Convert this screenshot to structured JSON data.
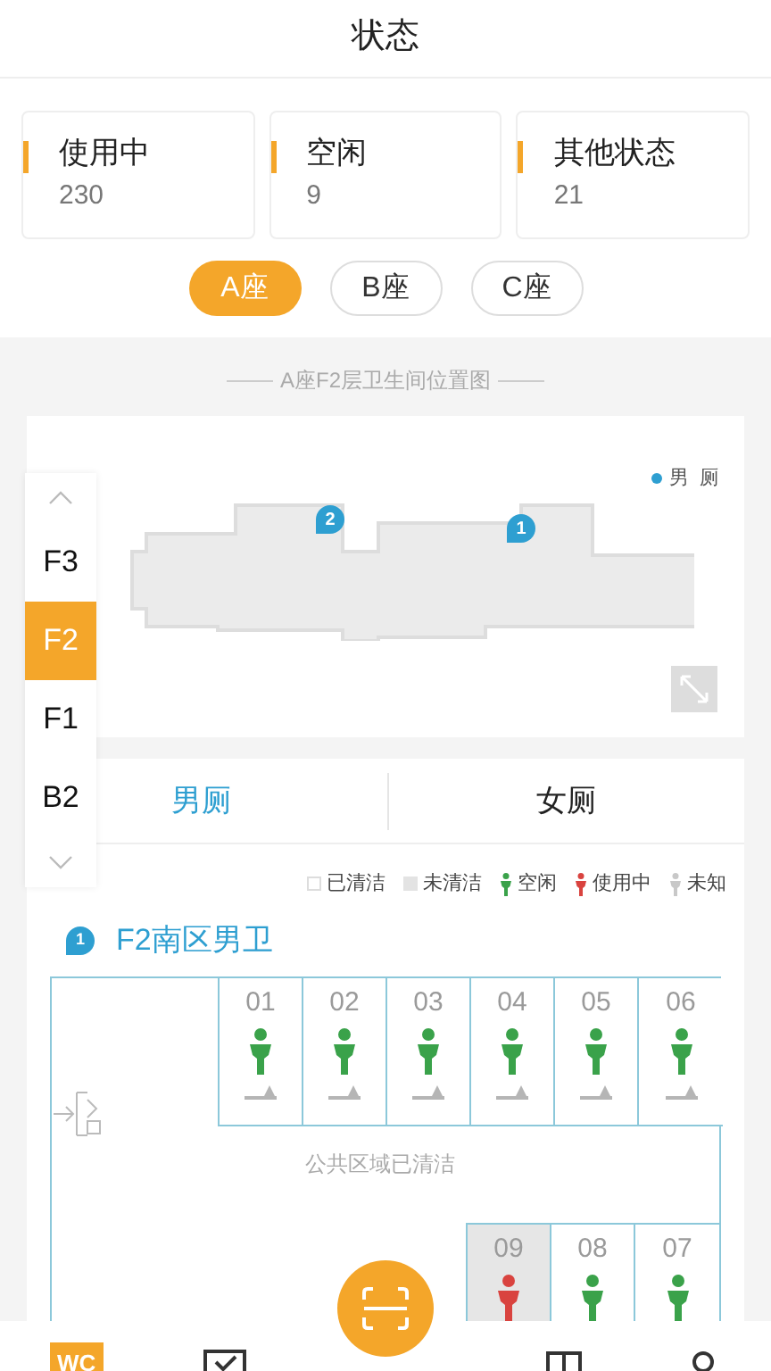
{
  "header": {
    "title": "状态"
  },
  "stats": [
    {
      "label": "使用中",
      "value": "230"
    },
    {
      "label": "空闲",
      "value": "9"
    },
    {
      "label": "其他状态",
      "value": "21"
    }
  ],
  "buildings": [
    {
      "label": "A座",
      "selected": true
    },
    {
      "label": "B座",
      "selected": false
    },
    {
      "label": "C座",
      "selected": false
    }
  ],
  "map": {
    "title": "A座F2层卫生间位置图",
    "legend": "男  厕",
    "pins": [
      {
        "number": "2"
      },
      {
        "number": "1"
      }
    ]
  },
  "floors": [
    {
      "label": "F3",
      "selected": false
    },
    {
      "label": "F2",
      "selected": true
    },
    {
      "label": "F1",
      "selected": false
    },
    {
      "label": "B2",
      "selected": false
    }
  ],
  "gender_tabs": [
    {
      "label": "男厕",
      "selected": true
    },
    {
      "label": "女厕",
      "selected": false
    }
  ],
  "legend": [
    {
      "kind": "cleaned",
      "label": "已清洁"
    },
    {
      "kind": "uncleaned",
      "label": "未清洁"
    },
    {
      "kind": "free",
      "label": "空闲"
    },
    {
      "kind": "occupied",
      "label": "使用中"
    },
    {
      "kind": "unknown",
      "label": "未知"
    }
  ],
  "restroom": {
    "number": "1",
    "name": "F2南区男卫",
    "public_area": "公共区域已清洁",
    "top_stalls": [
      {
        "number": "01",
        "occupied": false,
        "cleaned": true
      },
      {
        "number": "02",
        "occupied": false,
        "cleaned": true
      },
      {
        "number": "03",
        "occupied": false,
        "cleaned": true
      },
      {
        "number": "04",
        "occupied": false,
        "cleaned": true
      },
      {
        "number": "05",
        "occupied": false,
        "cleaned": true
      },
      {
        "number": "06",
        "occupied": false,
        "cleaned": true
      }
    ],
    "bottom_stalls": [
      {
        "number": "09",
        "occupied": true,
        "cleaned": false
      },
      {
        "number": "08",
        "occupied": false,
        "cleaned": true
      },
      {
        "number": "07",
        "occupied": false,
        "cleaned": true
      }
    ]
  },
  "nav": [
    {
      "kind": "wc",
      "label": "WC"
    },
    {
      "kind": "check"
    },
    {
      "kind": "scan"
    },
    {
      "kind": "doc"
    },
    {
      "kind": "user"
    }
  ]
}
